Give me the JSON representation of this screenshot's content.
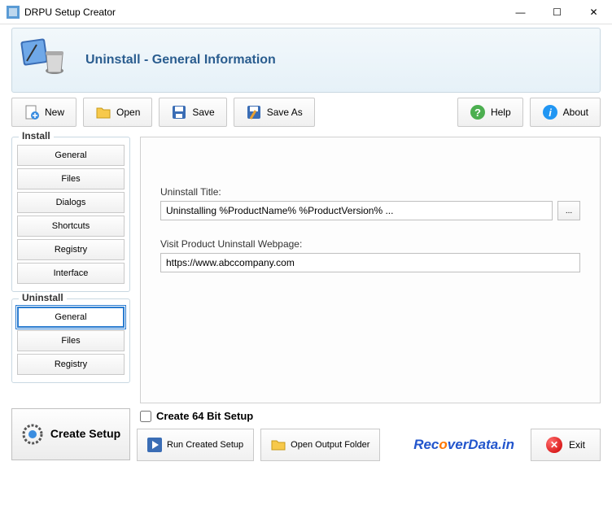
{
  "window": {
    "title": "DRPU Setup Creator"
  },
  "header": {
    "text": "Uninstall - General Information"
  },
  "toolbar": {
    "new": "New",
    "open": "Open",
    "save": "Save",
    "saveas": "Save As",
    "help": "Help",
    "about": "About"
  },
  "sidebar": {
    "install": {
      "title": "Install",
      "items": [
        "General",
        "Files",
        "Dialogs",
        "Shortcuts",
        "Registry",
        "Interface"
      ]
    },
    "uninstall": {
      "title": "Uninstall",
      "items": [
        "General",
        "Files",
        "Registry"
      ]
    }
  },
  "form": {
    "titleLabel": "Uninstall Title:",
    "titleValue": "Uninstalling %ProductName% %ProductVersion% ...",
    "browse": "...",
    "webLabel": "Visit Product Uninstall Webpage:",
    "webValue": "https://www.abccompany.com"
  },
  "footer": {
    "create": "Create Setup",
    "chk": "Create 64 Bit Setup",
    "run": "Run Created Setup",
    "open": "Open Output Folder",
    "exit": "Exit",
    "watermark1": "Rec",
    "watermark2": "o",
    "watermark3": "verData.in"
  }
}
